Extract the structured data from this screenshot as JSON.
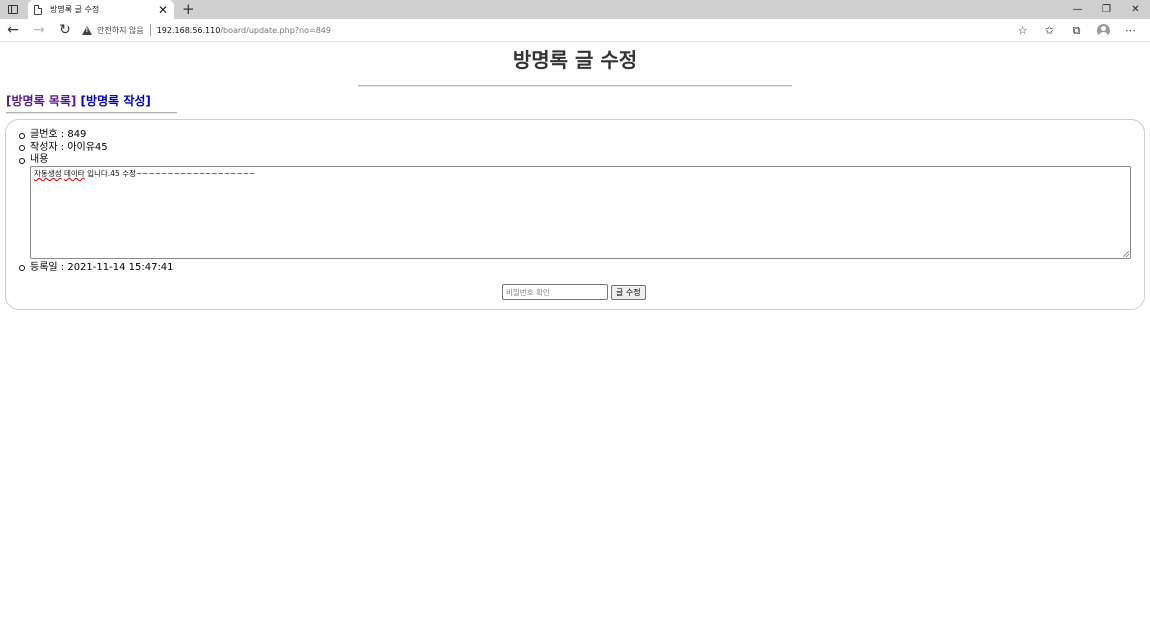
{
  "browser": {
    "tab_title": "방명록 글 수정",
    "tab_close": "✕",
    "new_tab": "+",
    "security_label": "안전하지 않음",
    "url_host": "192.168.56.110",
    "url_path": "/board/update.php?no=849"
  },
  "page": {
    "title": "방명록 글 수정",
    "links": {
      "list": "[방명록 목록]",
      "write": "[방명록 작성]"
    }
  },
  "form": {
    "post_number": "글번호 : 849",
    "author": "작성자 : 아이유45",
    "content_label": "내용",
    "content_words": {
      "w1": "자동생성",
      "w2": "데이타",
      "rest": " 입니다.45 수정~~~~~~~~~~~~~~~~~~~"
    },
    "reg_date": "등록일 : 2021-11-14 15:47:41",
    "password_placeholder": "비밀번호 확인",
    "submit_label": "글 수정"
  }
}
